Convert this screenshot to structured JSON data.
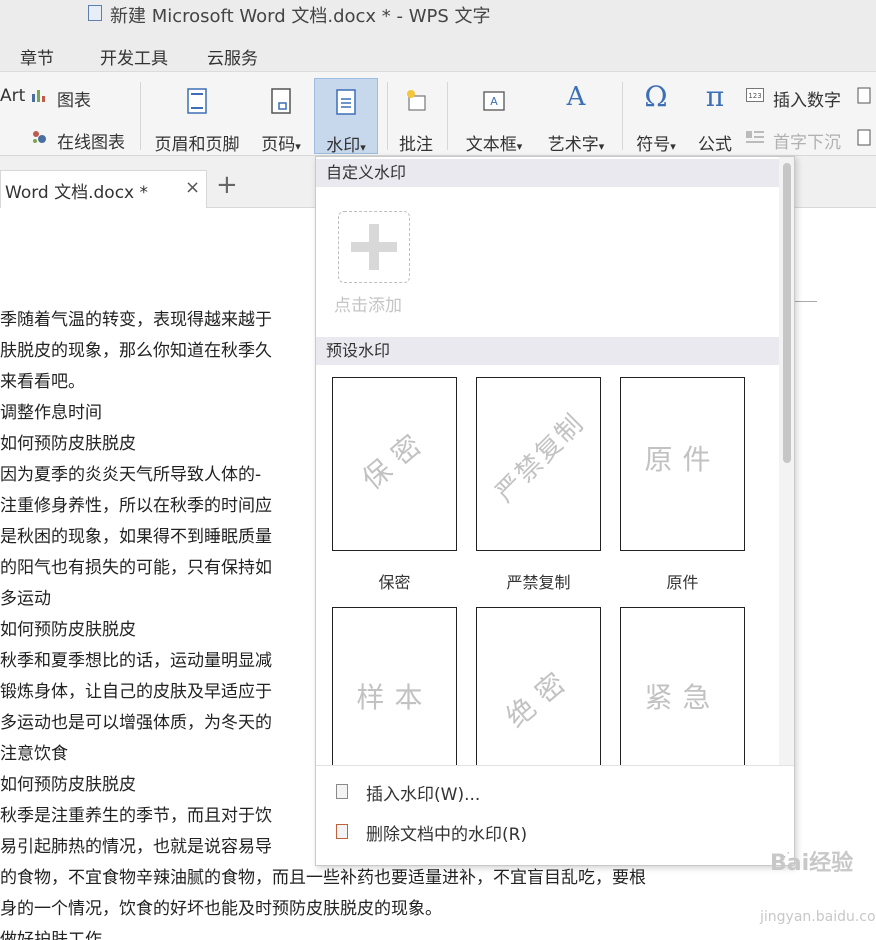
{
  "window": {
    "title": "新建 Microsoft Word 文档.docx * - WPS 文字"
  },
  "menu": {
    "items": [
      "章节",
      "开发工具",
      "云服务"
    ]
  },
  "ribbon": {
    "art": "Art",
    "chart": "图表",
    "online_chart": "在线图表",
    "header_footer": "页眉和页脚",
    "page_num": "页码",
    "watermark": "水印",
    "comment": "批注",
    "textbox": "文本框",
    "wordart": "艺术字",
    "symbol": "符号",
    "formula": "公式",
    "insert_num": "插入数字",
    "dropcap": "首字下沉",
    "symbol_glyph": "Ω",
    "formula_glyph": "π",
    "wordart_glyph": "A",
    "dropdown_glyph": "▾"
  },
  "tabs": {
    "doc_tab": "Word 文档.docx *",
    "close": "×",
    "add": "+"
  },
  "document": {
    "lines": [
      "季随着气温的转变，表现得越来越于",
      "肤脱皮的现象，那么你知道在秋季久",
      "来看看吧。",
      "调整作息时间",
      "如何预防皮肤脱皮",
      "因为夏季的炎炎天气所导致人体的-",
      "注重修身养性，所以在秋季的时间应",
      "是秋困的现象，如果得不到睡眠质量",
      "的阳气也有损失的可能，只有保持如",
      "多运动",
      "如何预防皮肤脱皮",
      "秋季和夏季想比的话，运动量明显减",
      "锻炼身体，让自己的皮肤及早适应于",
      "多运动也是可以增强体质，为冬天的",
      "注意饮食",
      "如何预防皮肤脱皮",
      "秋季是注重养生的季节，而且对于饮",
      "易引起肺热的情况，也就是说容易导",
      "的食物，不宜食物辛辣油腻的食物，而且一些补药也要适量进补，不宜盲目乱吃，要根",
      "身的一个情况，饮食的好坏也能及时预防皮肤脱皮的现象。",
      "做好护肤工作"
    ]
  },
  "watermark_menu": {
    "custom_header": "自定义水印",
    "add_label": "点击添加",
    "preset_header": "预设水印",
    "presets": [
      {
        "mark": "保密",
        "label": "保密"
      },
      {
        "mark": "严禁复制",
        "label": "严禁复制"
      },
      {
        "mark": "原件",
        "label": "原件"
      },
      {
        "mark": "样本",
        "label": ""
      },
      {
        "mark": "绝密",
        "label": ""
      },
      {
        "mark": "紧急",
        "label": ""
      }
    ],
    "insert": "插入水印(W)...",
    "delete": "删除文档中的水印(R)"
  },
  "site_watermark": {
    "text": "Bai经验",
    "url": "jingyan.baidu.com"
  },
  "colors": {
    "ribbon_active": "#c7d8ec",
    "accent_blue": "#3d6fb6"
  }
}
